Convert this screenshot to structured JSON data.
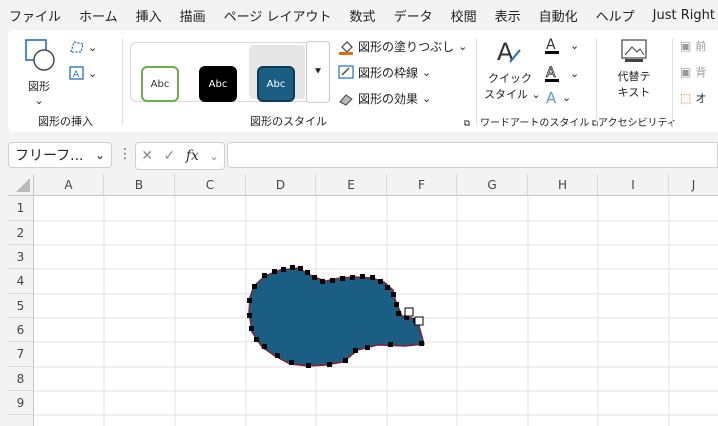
{
  "menu": [
    "ファイル",
    "ホーム",
    "挿入",
    "描画",
    "ページ レイアウト",
    "数式",
    "データ",
    "校閲",
    "表示",
    "自動化",
    "ヘルプ",
    "Just Right"
  ],
  "ribbon": {
    "insert_group": {
      "shape_label": "図形",
      "label": "図形の挿入"
    },
    "style_group": {
      "abc": [
        "Abc",
        "Abc",
        "Abc"
      ],
      "fill": "図形の塗りつぶし",
      "outline": "図形の枠線",
      "effects": "図形の効果",
      "label": "図形のスタイル"
    },
    "wordart_group": {
      "quick_style_line1": "クイック",
      "quick_style_line2": "スタイル",
      "label": "ワードアートのスタイル"
    },
    "accessibility_group": {
      "alt_text_line1": "代替テ",
      "alt_text_line2": "キスト",
      "label": "アクセシビリティ"
    },
    "arrange_group": {
      "item1": "前",
      "item2": "背",
      "item3": "オ"
    }
  },
  "formula_bar": {
    "name_box": "フリーフ...",
    "fx": "fx",
    "value": ""
  },
  "columns": [
    "A",
    "B",
    "C",
    "D",
    "E",
    "F",
    "G",
    "H",
    "I",
    "J"
  ],
  "rows": [
    "1",
    "2",
    "3",
    "4",
    "5",
    "6",
    "7",
    "8",
    "9"
  ],
  "colors": {
    "shape_fill": "#1b5e84",
    "shape_outline": "#8b1a2a",
    "accent_green": "#70ad47",
    "selected_bg": "#1b5e84"
  }
}
